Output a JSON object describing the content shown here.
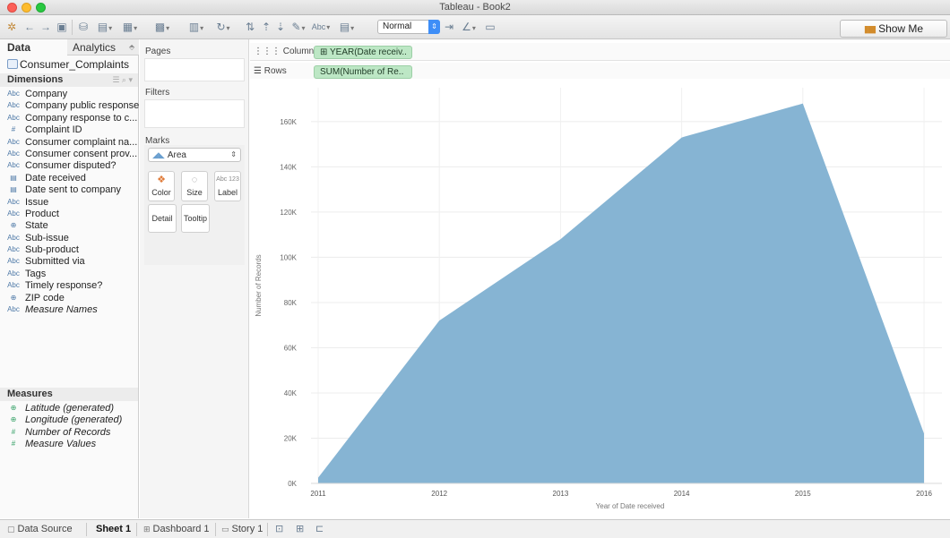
{
  "window": {
    "title": "Tableau - Book2"
  },
  "toolbar": {
    "fit_value": "Normal",
    "show_me_label": "Show Me"
  },
  "data_pane": {
    "tab_data": "Data",
    "tab_analytics": "Analytics",
    "datasource": "Consumer_Complaints",
    "dimensions_label": "Dimensions",
    "measures_label": "Measures",
    "dimensions": [
      {
        "icon": "Abc",
        "label": "Company"
      },
      {
        "icon": "Abc",
        "label": "Company public response"
      },
      {
        "icon": "Abc",
        "label": "Company response to c..."
      },
      {
        "icon": "#",
        "label": "Complaint ID"
      },
      {
        "icon": "Abc",
        "label": "Consumer complaint na..."
      },
      {
        "icon": "Abc",
        "label": "Consumer consent prov..."
      },
      {
        "icon": "Abc",
        "label": "Consumer disputed?"
      },
      {
        "icon": "date",
        "label": "Date received"
      },
      {
        "icon": "date",
        "label": "Date sent to company"
      },
      {
        "icon": "Abc",
        "label": "Issue"
      },
      {
        "icon": "Abc",
        "label": "Product"
      },
      {
        "icon": "geo",
        "label": "State"
      },
      {
        "icon": "Abc",
        "label": "Sub-issue"
      },
      {
        "icon": "Abc",
        "label": "Sub-product"
      },
      {
        "icon": "Abc",
        "label": "Submitted via"
      },
      {
        "icon": "Abc",
        "label": "Tags"
      },
      {
        "icon": "Abc",
        "label": "Timely response?"
      },
      {
        "icon": "geo",
        "label": "ZIP code"
      },
      {
        "icon": "Abc",
        "label": "Measure Names"
      }
    ],
    "measures": [
      {
        "icon": "geo",
        "label": "Latitude (generated)"
      },
      {
        "icon": "geo",
        "label": "Longitude (generated)"
      },
      {
        "icon": "#",
        "label": "Number of Records"
      },
      {
        "icon": "#",
        "label": "Measure Values"
      }
    ]
  },
  "cards": {
    "pages": "Pages",
    "filters": "Filters",
    "marks": "Marks",
    "mark_type": "Area",
    "color": "Color",
    "size": "Size",
    "label": "Label",
    "label_icon": "Abc 123",
    "detail": "Detail",
    "tooltip": "Tooltip"
  },
  "shelves": {
    "columns_label": "Columns",
    "columns_pill": "YEAR(Date receiv..",
    "rows_label": "Rows",
    "rows_pill": "SUM(Number of Re.."
  },
  "chart_data": {
    "type": "area",
    "xlabel": "Year of Date received",
    "ylabel": "Number of Records",
    "categories": [
      "2011",
      "2012",
      "2013",
      "2014",
      "2015",
      "2016"
    ],
    "values": [
      2500,
      72000,
      108000,
      153000,
      168000,
      22000
    ],
    "yticks": [
      "0K",
      "20K",
      "40K",
      "60K",
      "80K",
      "100K",
      "120K",
      "140K",
      "160K"
    ],
    "ylim": [
      0,
      175000
    ],
    "fill_color": "#86b4d3",
    "grid": true
  },
  "bottom_tabs": {
    "data_source": "Data Source",
    "sheet1": "Sheet 1",
    "dashboard1": "Dashboard 1",
    "story1": "Story 1"
  }
}
